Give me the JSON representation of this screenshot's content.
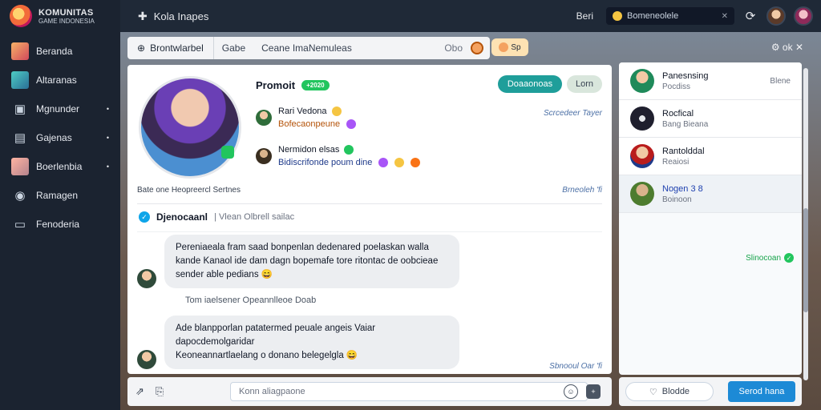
{
  "brand": {
    "title": "KOMUNITAS",
    "subtitle": "GAME INDONESIA"
  },
  "sidebar": {
    "items": [
      {
        "label": "Beranda",
        "icon": "avatar-icon",
        "dot": ""
      },
      {
        "label": "Altaranas",
        "icon": "avatar-icon",
        "dot": ""
      },
      {
        "label": "Mgnunder",
        "icon": "gamepad-icon",
        "dot": "•"
      },
      {
        "label": "Gajenas",
        "icon": "chat-icon",
        "dot": "•"
      },
      {
        "label": "Boerlenbia",
        "icon": "avatar-icon",
        "dot": "•"
      },
      {
        "label": "Ramagen",
        "icon": "record-icon",
        "dot": ""
      },
      {
        "label": "Fenoderia",
        "icon": "window-icon",
        "dot": ""
      }
    ]
  },
  "topbar": {
    "title": "Kola Inapes",
    "link": "Beri",
    "search_text": "Bomeneolele",
    "search_close": "✕"
  },
  "subnav": {
    "crumb": "Brontwlarbel",
    "tab1": "Gabe",
    "tab2": "Ceane ImaNemuleas",
    "count": "Obo",
    "chip_text": "Sp",
    "right_tools": "⚙ ok ✕"
  },
  "profile": {
    "promo_title": "Promoit",
    "promo_badge": "+2020",
    "btn_primary": "Doaaonoas",
    "btn_secondary": "Lorn",
    "meta_right": "Scrcedeer Tayer",
    "friend1_name": "Rari Vedona",
    "friend1_status": "Bofecaonpeune",
    "friend2_name": "Nermidon elsas",
    "friend2_status": "Bidiscrifonde poum dine",
    "meta_left": "Bate one Heopreercl Sertnes",
    "meta_right2": "Brneoleh 'fi"
  },
  "thread": {
    "name": "Djenocaanl",
    "check": "✓",
    "sub": "| Vlean Olbrell sailac",
    "messages": [
      "Pereniaeala fram saad bonpenlan dedenared poelaskan walla\nkande Kanaol ide dam dagn bopemafe tore ritontac de oobcieae\nsender able pedians 😄",
      "Ade blanpporlan patatermed peuale angeis Vaiar dapocdemolgaridar\nKeoneannartlaelang o donano belegelgla 😄"
    ],
    "middle_note": "Tom iaelsener Opeannlleoe Doab",
    "meta_bottom": "Sbnooul Oar 'fi"
  },
  "composer": {
    "placeholder": "Konn aliagpaone"
  },
  "right_panel": {
    "items": [
      {
        "name": "Panesnsing",
        "status": "Pocdiss",
        "time": "Blene"
      },
      {
        "name": "Rocfical",
        "status": "Bang Bieana",
        "time": ""
      },
      {
        "name": "Rantolddal",
        "status": "Reaiosi",
        "time": ""
      },
      {
        "name": "Nogen 3 8",
        "status": "Boinoon",
        "time": ""
      }
    ],
    "footer": "Slinocoan",
    "ghost_button": "Blodde",
    "send_button": "Serod hana"
  },
  "colors": {
    "sidebar_bg": "#1b2330",
    "accent_teal": "#1f9e9a",
    "accent_blue": "#1d8ad6",
    "online_green": "#22c55e"
  }
}
